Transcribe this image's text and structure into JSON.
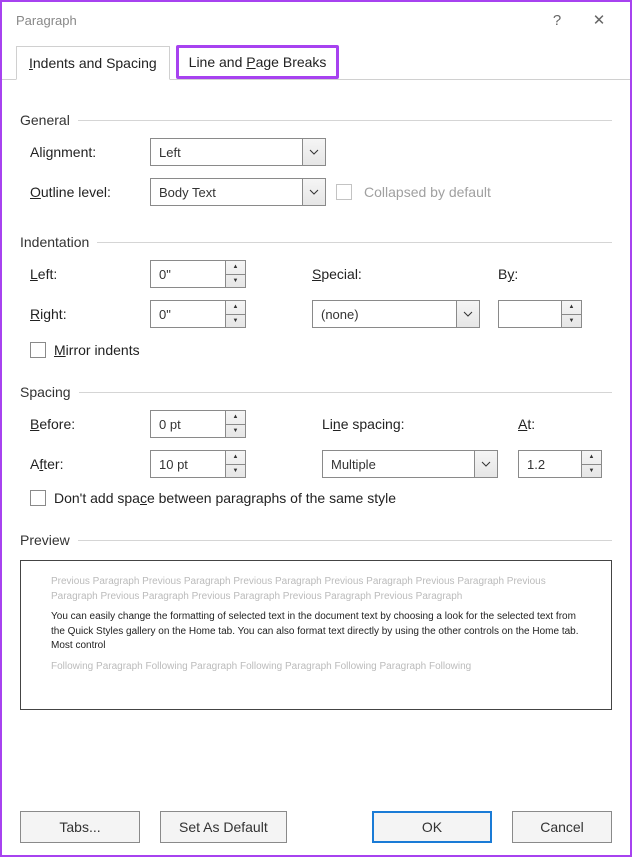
{
  "titlebar": {
    "title": "Paragraph",
    "help": "?",
    "close": "✕"
  },
  "tabs": {
    "indents": "Indents and Spacing",
    "breaks": "Line and Page Breaks"
  },
  "general": {
    "heading": "General",
    "alignment_label": "Alignment:",
    "alignment_value": "Left",
    "outline_label": "Outline level:",
    "outline_value": "Body Text",
    "collapsed_label": "Collapsed by default"
  },
  "indentation": {
    "heading": "Indentation",
    "left_label": "Left:",
    "left_value": "0\"",
    "right_label": "Right:",
    "right_value": "0\"",
    "special_label": "Special:",
    "special_value": "(none)",
    "by_label": "By:",
    "by_value": "",
    "mirror_label": "Mirror indents"
  },
  "spacing": {
    "heading": "Spacing",
    "before_label": "Before:",
    "before_value": "0 pt",
    "after_label": "After:",
    "after_value": "10 pt",
    "line_label": "Line spacing:",
    "line_value": "Multiple",
    "at_label": "At:",
    "at_value": "1.2",
    "dont_add_label": "Don't add space between paragraphs of the same style"
  },
  "preview": {
    "heading": "Preview",
    "prev_text": "Previous Paragraph Previous Paragraph Previous Paragraph Previous Paragraph Previous Paragraph Previous Paragraph Previous Paragraph Previous Paragraph Previous Paragraph Previous Paragraph",
    "main_text": "You can easily change the formatting of selected text in the document text by choosing a look for the selected text from the Quick Styles gallery on the Home tab. You can also format text directly by using the other controls on the Home tab. Most control",
    "next_text": "Following Paragraph Following Paragraph Following Paragraph Following Paragraph Following"
  },
  "buttons": {
    "tabs": "Tabs...",
    "default": "Set As Default",
    "ok": "OK",
    "cancel": "Cancel"
  }
}
